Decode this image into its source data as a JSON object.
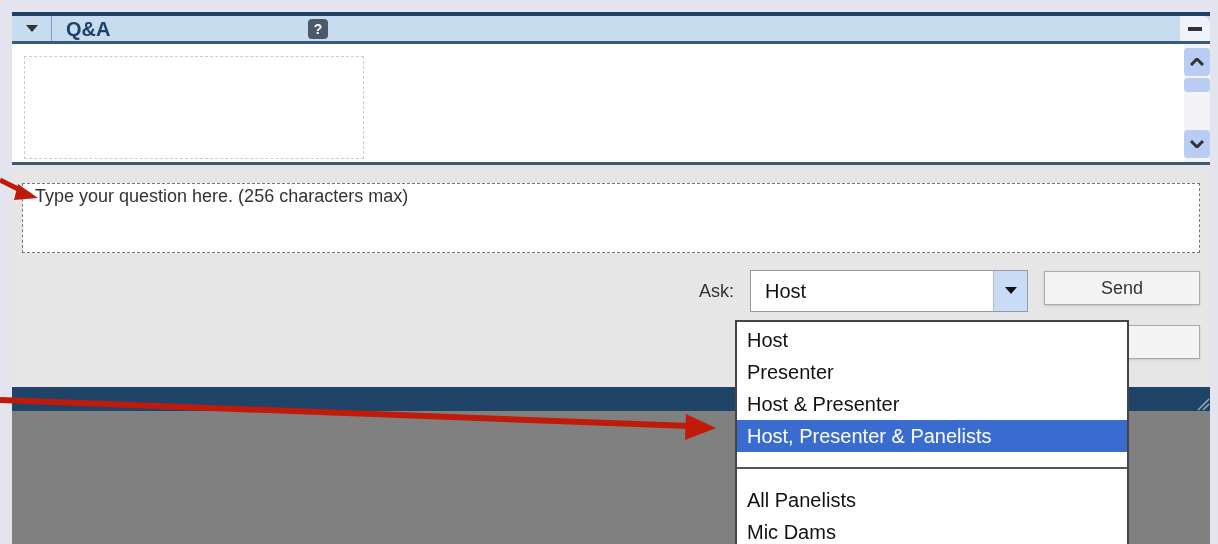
{
  "panel": {
    "title": "Q&A",
    "help": "?"
  },
  "question": {
    "placeholder": "Type your question here. (256 characters max)"
  },
  "ask": {
    "label": "Ask:",
    "value": "Host",
    "expanded": true
  },
  "send_button": "Send",
  "dropdown": [
    {
      "kind": "option",
      "label": "Host",
      "selected": false
    },
    {
      "kind": "option",
      "label": "Presenter",
      "selected": false
    },
    {
      "kind": "option",
      "label": "Host & Presenter",
      "selected": false
    },
    {
      "kind": "option",
      "label": "Host, Presenter & Panelists",
      "selected": true
    },
    {
      "kind": "separator"
    },
    {
      "kind": "option",
      "label": "All Panelists",
      "selected": false
    },
    {
      "kind": "option",
      "label": "Mic Dams",
      "selected": false
    }
  ]
}
